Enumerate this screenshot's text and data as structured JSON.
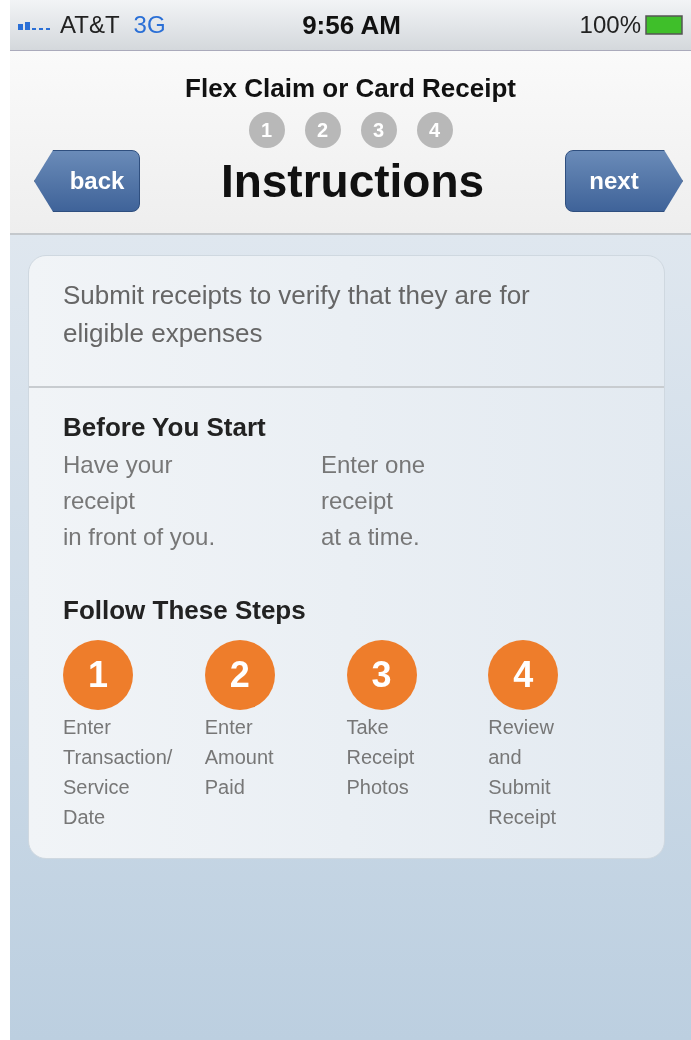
{
  "status_bar": {
    "carrier": "AT&T",
    "network": "3G",
    "time": "9:56 AM",
    "battery": "100%"
  },
  "header": {
    "subtitle": "Flex Claim or Card Receipt",
    "progress": [
      "1",
      "2",
      "3",
      "4"
    ],
    "title": "Instructions",
    "back": "back",
    "next": "next"
  },
  "intro": "Submit receipts to verify that they are for eligible expenses",
  "before": {
    "heading": "Before You Start",
    "tips": [
      {
        "lines": [
          "Have your",
          "receipt",
          "in front of you."
        ]
      },
      {
        "lines": [
          "Enter one",
          "receipt",
          "at a time."
        ]
      }
    ]
  },
  "steps": {
    "heading": "Follow These Steps",
    "items": [
      {
        "number": "1",
        "lines": [
          "Enter",
          "Transaction/",
          "Service",
          "Date"
        ]
      },
      {
        "number": "2",
        "lines": [
          "Enter",
          "Amount",
          "Paid"
        ]
      },
      {
        "number": "3",
        "lines": [
          "Take",
          "Receipt",
          "Photos"
        ]
      },
      {
        "number": "4",
        "lines": [
          "Review",
          "and",
          "Submit",
          "Receipt"
        ]
      }
    ]
  }
}
